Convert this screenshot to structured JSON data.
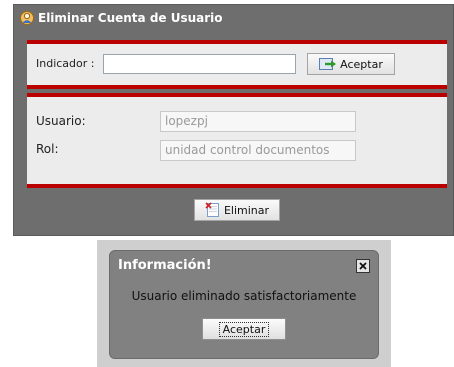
{
  "window": {
    "title": "Eliminar Cuenta de Usuario",
    "title_icon": "user-icon"
  },
  "search": {
    "label": "Indicador :",
    "value": "",
    "accept_label": "Aceptar",
    "accept_icon": "arrow-go-icon"
  },
  "details": {
    "user_label": "Usuario:",
    "user_value": "lopezpj",
    "role_label": "Rol:",
    "role_value": "unidad control documentos"
  },
  "actions": {
    "delete_label": "Eliminar",
    "delete_icon": "delete-document-icon"
  },
  "dialog": {
    "title": "Información!",
    "message": "Usuario eliminado satisfactoriamente",
    "ok_label": "Aceptar"
  },
  "colors": {
    "accent_red": "#bb0000",
    "window_gray": "#6e6e6e",
    "panel_bg": "#ececec"
  }
}
